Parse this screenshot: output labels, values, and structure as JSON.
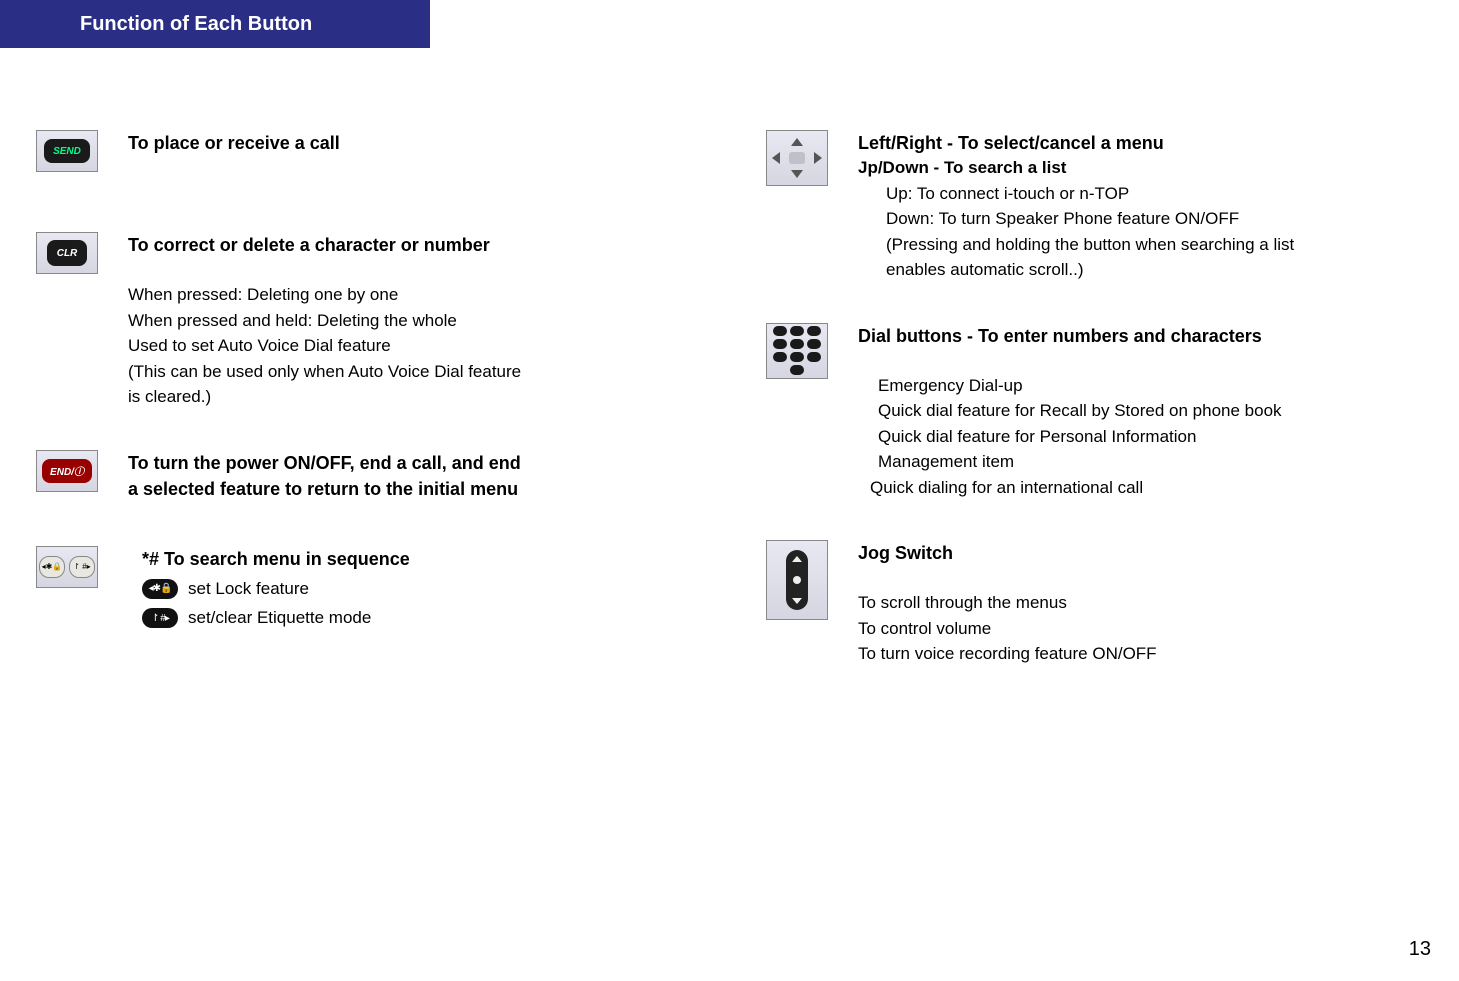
{
  "title": "Function of Each Button",
  "page_number": "13",
  "left": {
    "send": {
      "heading": "To place or receive a call"
    },
    "clr": {
      "heading": "To correct or delete a character or number",
      "l1": "When pressed: Deleting one by one",
      "l2": "When pressed and held: Deleting the whole",
      "l3": "Used to set Auto Voice Dial feature",
      "l4": "(This can be used only when Auto Voice Dial feature",
      "l5": "is cleared.)"
    },
    "end": {
      "heading1": "To turn the power ON/OFF, end a call, and end",
      "heading2": "a selected feature to return to the initial menu"
    },
    "starhash": {
      "heading": "*# To search menu in sequence",
      "l1": "set Lock feature",
      "l2": "set/clear Etiquette mode"
    }
  },
  "right": {
    "nav": {
      "heading": "Left/Right - To select/cancel a menu",
      "sub": "Jp/Down - To search a list",
      "l1": "Up: To connect i-touch or n-TOP",
      "l2": "Down: To turn Speaker Phone feature ON/OFF",
      "l3": "(Pressing and holding the button when searching a list",
      "l4": "enables automatic scroll..)"
    },
    "dial": {
      "heading": "Dial buttons - To enter numbers and characters",
      "l1": "Emergency Dial-up",
      "l2": "Quick dial feature for Recall by Stored on phone book",
      "l3": "Quick dial feature for Personal Information",
      "l4": " Management item",
      "l5": "Quick dialing for an international call"
    },
    "jog": {
      "heading": "Jog Switch",
      "l1": "To scroll through the menus",
      "l2": "To control volume",
      "l3": "To turn voice recording feature ON/OFF"
    }
  },
  "icon_labels": {
    "send": "SEND",
    "clr": "CLR",
    "end": "END/ⓘ",
    "star": "◂✱🔒",
    "hash": "↾ #▸"
  }
}
